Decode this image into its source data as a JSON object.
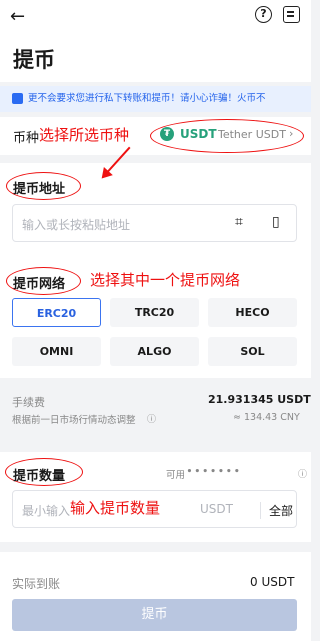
{
  "header": {
    "title": "提币"
  },
  "notice": "更不会要求您进行私下转账和提币！请小心诈骗！火币不",
  "coin": {
    "label": "币种",
    "annotation": "选择所选币种",
    "symbol": "USDT",
    "name": "Tether USDT"
  },
  "address": {
    "label": "提币地址",
    "placeholder": "输入或长按粘贴地址"
  },
  "network": {
    "label": "提币网络",
    "annotation": "选择其中一个提币网络",
    "options": [
      "ERC20",
      "TRC20",
      "HECO",
      "OMNI",
      "ALGO",
      "SOL"
    ],
    "selected": "ERC20"
  },
  "fee": {
    "label": "手续费",
    "value": "21.931345 USDT",
    "note": "根据前一日市场行情动态调整",
    "converted": "≈ 134.43 CNY"
  },
  "amount": {
    "label": "提币数量",
    "available": "可用",
    "placeholder": "最小输入",
    "annotation": "输入提币数量",
    "unit": "USDT",
    "all": "全部"
  },
  "received": {
    "label": "实际到账",
    "value": "0 USDT"
  },
  "submit": "提币",
  "colors": {
    "accent": "#2a62e0",
    "annotation": "#e11111",
    "tether": "#26a17b"
  }
}
